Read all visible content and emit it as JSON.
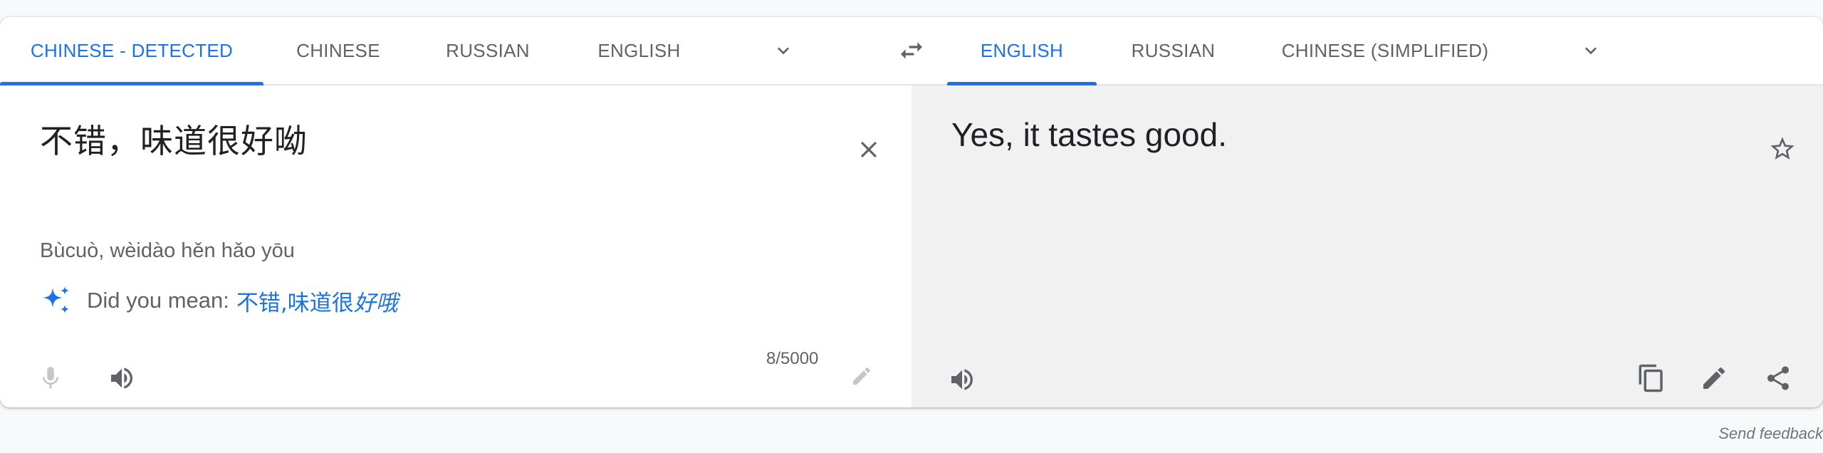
{
  "source_tabs": [
    "CHINESE - DETECTED",
    "CHINESE",
    "RUSSIAN",
    "ENGLISH"
  ],
  "target_tabs": [
    "ENGLISH",
    "RUSSIAN",
    "CHINESE (SIMPLIFIED)"
  ],
  "source": {
    "text": "不错，味道很好呦",
    "transliteration": "Bùcuò, wèidào hěn hǎo yōu",
    "did_you_mean_label": "Did you mean:",
    "suggestion_prefix": "不错,味道很",
    "suggestion_emphasis": "好哦",
    "char_count": "8/5000"
  },
  "target": {
    "text": "Yes, it tastes good."
  },
  "footer": {
    "send_feedback": "Send feedback"
  },
  "colors": {
    "accent": "#1a73e8",
    "target_bg": "#f1f1f1"
  },
  "icons": [
    "chevron-down-icon",
    "swap-languages-icon",
    "close-icon",
    "sparkle-icon",
    "microphone-icon",
    "speaker-icon",
    "pencil-icon",
    "star-icon",
    "copy-icon",
    "share-icon"
  ]
}
